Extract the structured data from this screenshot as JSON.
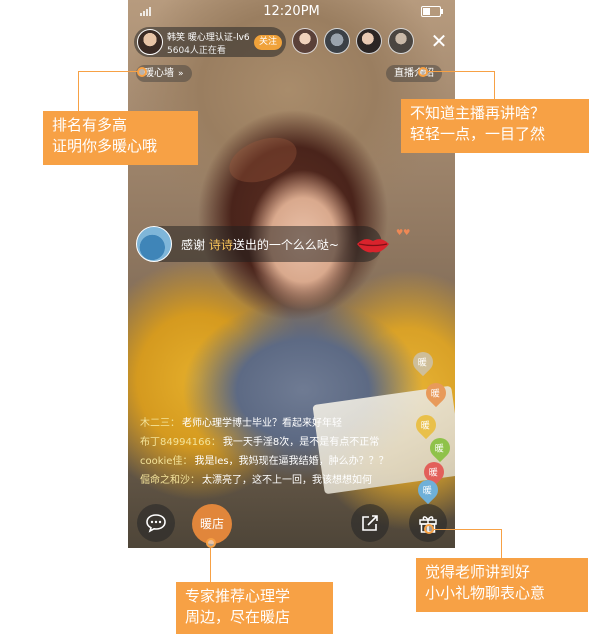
{
  "status_bar": {
    "time": "12:20PM"
  },
  "host": {
    "name": "韩笑 暖心理认证-lv6",
    "viewers": "5604人正在看",
    "follow_label": "关注"
  },
  "buttons": {
    "warm_wall": "暖心墙",
    "live_intro": "直播介绍",
    "shop": "暖店"
  },
  "gift_banner": {
    "prefix": "感谢 ",
    "user": "诗诗",
    "suffix": "送出的一个么么哒~"
  },
  "chat": [
    {
      "user": "木二三：",
      "text": "老师心理学博士毕业？看起来好年轻"
    },
    {
      "user": "布丁84994166：",
      "text": "我一天手淫8次，是不是有点不正常"
    },
    {
      "user": "cookie佳：",
      "text": "我是les，我妈现在逼我结婚，肿么办？？？"
    },
    {
      "user": "倔命之和沙：",
      "text": "太漂亮了，这不上一回，我该想想如何"
    }
  ],
  "hearts": [
    "暖",
    "暖",
    "暖",
    "暖",
    "暖",
    "暖"
  ],
  "annotations": {
    "left_top": [
      "排名有多高",
      "证明你多暖心哦"
    ],
    "right_top": [
      "不知道主播再讲啥？",
      "轻轻一点，一目了然"
    ],
    "bottom_center": [
      "专家推荐心理学",
      "周边，尽在暖店"
    ],
    "bottom_right": [
      "觉得老师讲到好",
      "小小礼物聊表心意"
    ]
  },
  "colors": {
    "accent": "#f7a145",
    "follow": "#f0a23a",
    "shop": "#e1863b"
  },
  "icons": [
    "signal-icon",
    "battery-icon",
    "close-icon",
    "chevron-right-icon",
    "chat-bubble-icon",
    "share-icon",
    "gift-icon",
    "lips-icon"
  ]
}
